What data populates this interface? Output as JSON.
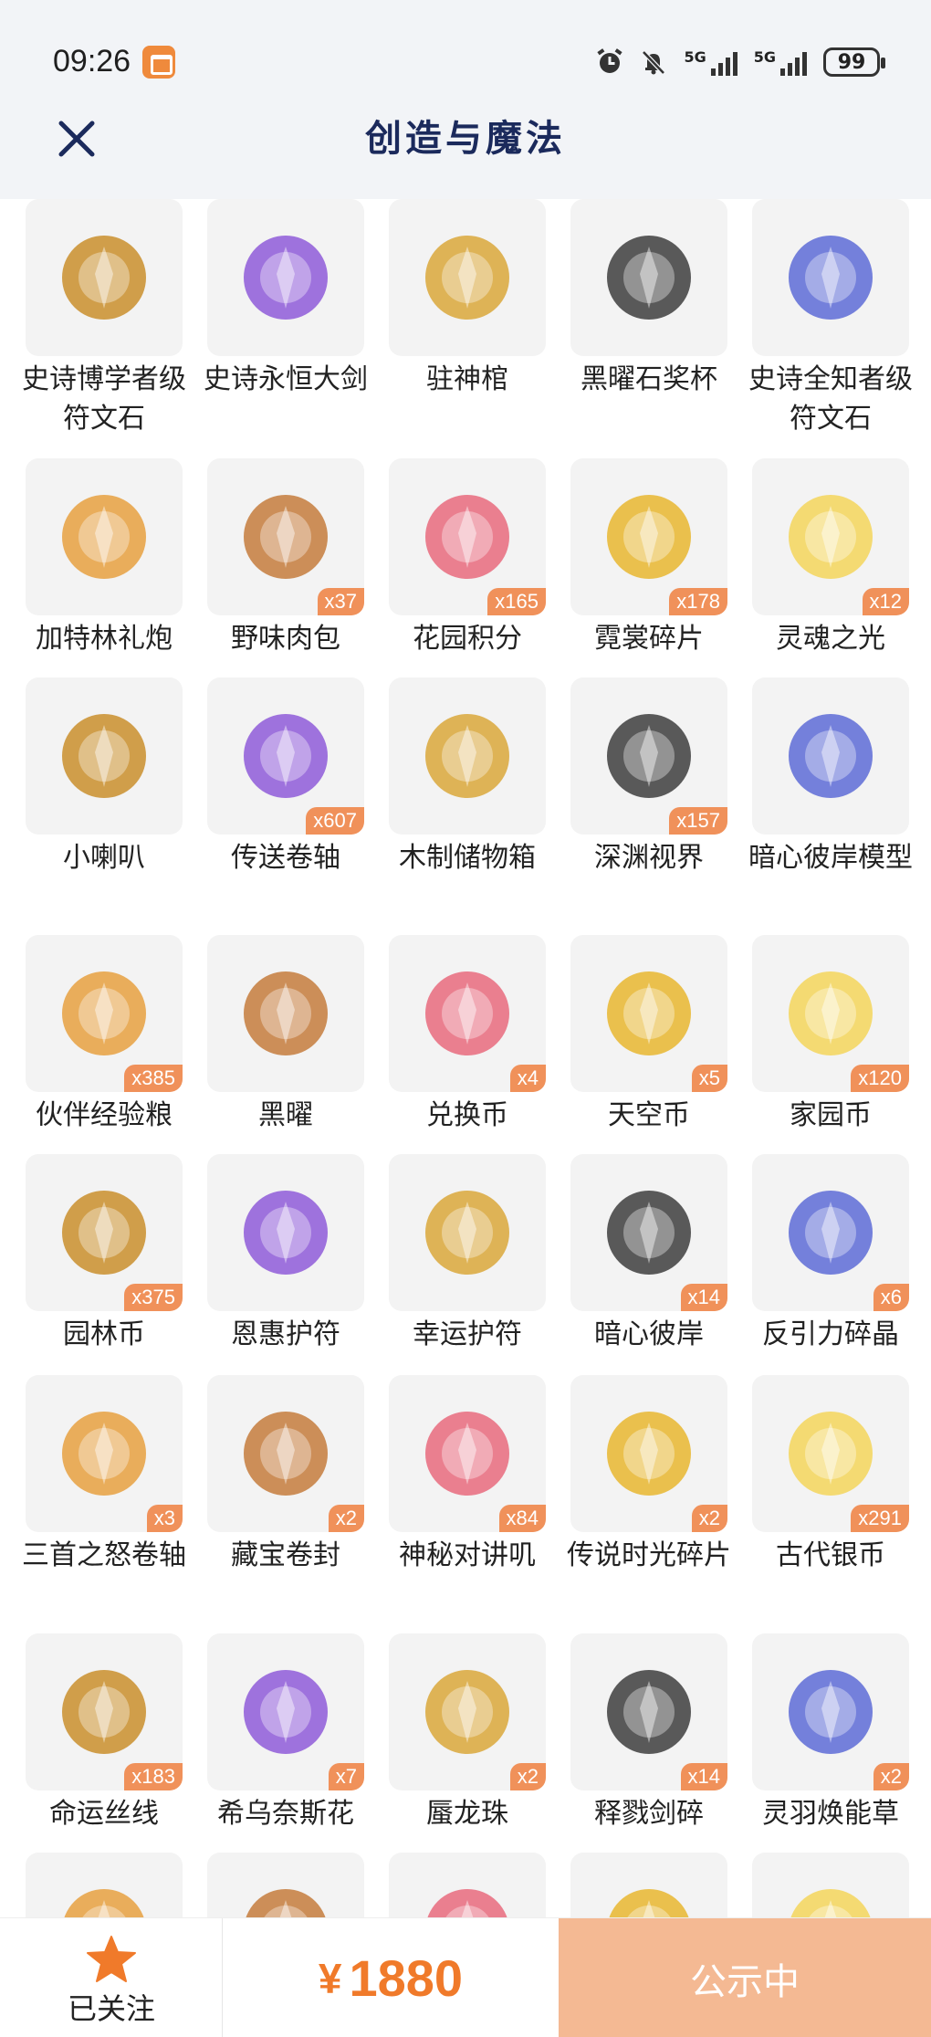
{
  "status_bar": {
    "time": "09:26",
    "net1": "5G",
    "net2": "5G",
    "battery": "99"
  },
  "header": {
    "title": "创造与魔法",
    "close_icon": "close-icon"
  },
  "colors": {
    "accent": "#f07a2a",
    "badge": "#f0915a",
    "title": "#1b2a5c",
    "status_button": "#f4b993"
  },
  "items": [
    {
      "name": "史诗博学者级符文石",
      "qty": "",
      "icon": "rune-stone-gold-purple"
    },
    {
      "name": "史诗永恒大剑",
      "qty": "",
      "icon": "greatsword"
    },
    {
      "name": "驻神棺",
      "qty": "",
      "icon": "shrine"
    },
    {
      "name": "黑曜石奖杯",
      "qty": "",
      "icon": "obsidian-trophy"
    },
    {
      "name": "史诗全知者级符文石",
      "qty": "",
      "icon": "rune-stone-blue"
    },
    {
      "name": "加特林礼炮",
      "qty": "",
      "icon": "gatling-cannon"
    },
    {
      "name": "野味肉包",
      "qty": "x37",
      "icon": "steamed-buns"
    },
    {
      "name": "花园积分",
      "qty": "x165",
      "icon": "flower-badge"
    },
    {
      "name": "霓裳碎片",
      "qty": "x178",
      "icon": "shirt-fragment"
    },
    {
      "name": "灵魂之光",
      "qty": "x12",
      "icon": "soul-light"
    },
    {
      "name": "小喇叭",
      "qty": "",
      "icon": "megaphone"
    },
    {
      "name": "传送卷轴",
      "qty": "x607",
      "icon": "teleport-scroll"
    },
    {
      "name": "木制储物箱",
      "qty": "",
      "icon": "wooden-box"
    },
    {
      "name": "深渊视界",
      "qty": "x157",
      "icon": "abyss-eye"
    },
    {
      "name": "暗心彼岸模型",
      "qty": "",
      "icon": "spider-lily-model"
    },
    {
      "name": "伙伴经验粮",
      "qty": "x385",
      "icon": "pet-food-bag"
    },
    {
      "name": "黑曜",
      "qty": "",
      "icon": "black-car"
    },
    {
      "name": "兑换币",
      "qty": "x4",
      "icon": "exchange-coin"
    },
    {
      "name": "天空币",
      "qty": "x5",
      "icon": "sky-coin"
    },
    {
      "name": "家园币",
      "qty": "x120",
      "icon": "home-coin"
    },
    {
      "name": "园林币",
      "qty": "x375",
      "icon": "garden-coin"
    },
    {
      "name": "恩惠护符",
      "qty": "",
      "icon": "grace-amulet"
    },
    {
      "name": "幸运护符",
      "qty": "",
      "icon": "luck-amulet"
    },
    {
      "name": "暗心彼岸",
      "qty": "x14",
      "icon": "spider-lily"
    },
    {
      "name": "反引力碎晶",
      "qty": "x6",
      "icon": "antigravity-crystal"
    },
    {
      "name": "三首之怒卷轴",
      "qty": "x3",
      "icon": "dark-scroll"
    },
    {
      "name": "藏宝卷封",
      "qty": "x2",
      "icon": "treasure-scroll"
    },
    {
      "name": "神秘对讲叽",
      "qty": "x84",
      "icon": "walkie-bird"
    },
    {
      "name": "传说时光碎片",
      "qty": "x2",
      "icon": "time-fragment"
    },
    {
      "name": "古代银币",
      "qty": "x291",
      "icon": "silver-coin"
    },
    {
      "name": "命运丝线",
      "qty": "x183",
      "icon": "fate-thread"
    },
    {
      "name": "希乌奈斯花",
      "qty": "x7",
      "icon": "red-flower"
    },
    {
      "name": "蜃龙珠",
      "qty": "x2",
      "icon": "purple-orb"
    },
    {
      "name": "释戮剑碎",
      "qty": "x14",
      "icon": "sword-shard"
    },
    {
      "name": "灵羽焕能草",
      "qty": "x2",
      "icon": "feather-grass"
    },
    {
      "name": "",
      "qty": "",
      "icon": "partial-item-1"
    },
    {
      "name": "",
      "qty": "",
      "icon": "partial-item-2"
    },
    {
      "name": "",
      "qty": "",
      "icon": "partial-item-3"
    },
    {
      "name": "",
      "qty": "",
      "icon": "partial-item-4"
    },
    {
      "name": "",
      "qty": "",
      "icon": "partial-item-5"
    }
  ],
  "bottom_bar": {
    "follow_label": "已关注",
    "currency": "¥",
    "price": "1880",
    "status_button": "公示中"
  }
}
